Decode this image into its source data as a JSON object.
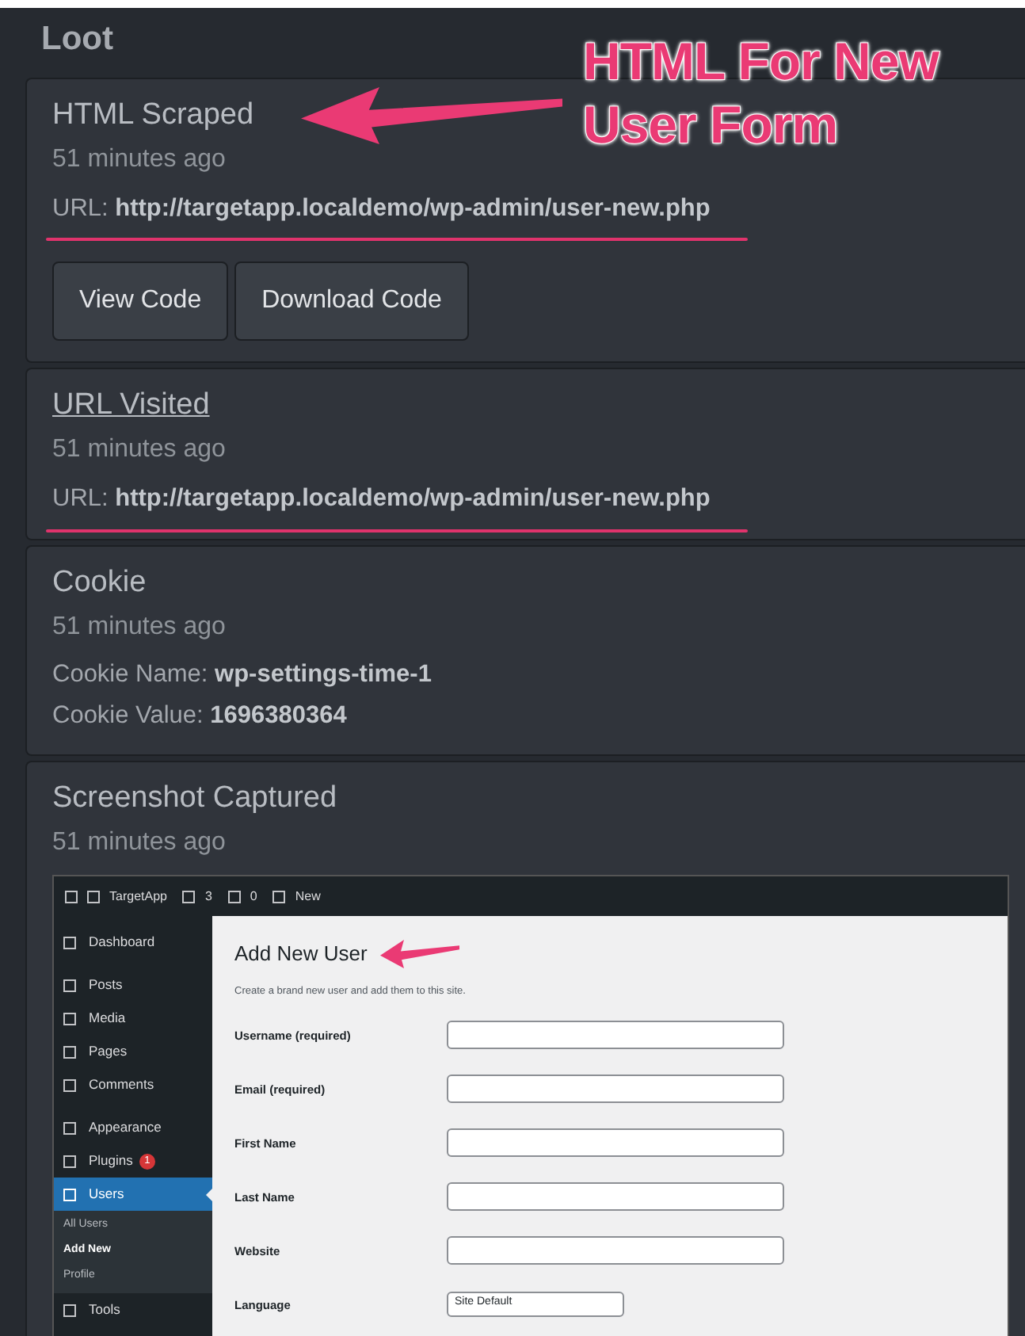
{
  "section_title": "Loot",
  "callout": {
    "text": "HTML For New User Form"
  },
  "loot_items": [
    {
      "kind": "html",
      "title": "HTML Scraped",
      "title_link": false,
      "title_arrow": true,
      "time": "51 minutes ago",
      "url_label": "URL:",
      "url": "http://targetapp.localdemo/wp-admin/user-new.php",
      "underlined": true,
      "buttons": [
        "View Code",
        "Download Code"
      ]
    },
    {
      "kind": "url",
      "title": "URL Visited",
      "title_link": true,
      "title_arrow": false,
      "time": "51 minutes ago",
      "url_label": "URL:",
      "url": "http://targetapp.localdemo/wp-admin/user-new.php",
      "underlined": true
    },
    {
      "kind": "cookie",
      "title": "Cookie",
      "title_link": false,
      "title_arrow": false,
      "time": "51 minutes ago",
      "fields": [
        {
          "label": "Cookie Name:",
          "value": "wp-settings-time-1"
        },
        {
          "label": "Cookie Value:",
          "value": "1696380364"
        }
      ]
    },
    {
      "kind": "screenshot",
      "title": "Screenshot Captured",
      "title_link": false,
      "title_arrow": false,
      "time": "51 minutes ago",
      "screenshot": {
        "admin_bar": [
          "TargetApp",
          "3",
          "0",
          "New"
        ],
        "menu_groups": [
          [
            {
              "label": "Dashboard",
              "selected": false
            }
          ],
          [
            {
              "label": "Posts",
              "selected": false
            },
            {
              "label": "Media",
              "selected": false
            },
            {
              "label": "Pages",
              "selected": false
            },
            {
              "label": "Comments",
              "selected": false
            }
          ],
          [
            {
              "label": "Appearance",
              "selected": false
            },
            {
              "label": "Plugins",
              "selected": false,
              "badge": "1"
            },
            {
              "label": "Users",
              "selected": true,
              "children": [
                {
                  "label": "All Users",
                  "selected": false
                },
                {
                  "label": "Add New",
                  "selected": true
                },
                {
                  "label": "Profile",
                  "selected": false
                }
              ]
            },
            {
              "label": "Tools",
              "selected": false
            }
          ]
        ],
        "heading": "Add New User",
        "heading_arrow": true,
        "description": "Create a brand new user and add them to this site.",
        "fields": [
          {
            "kind": "text",
            "label": "Username (required)"
          },
          {
            "kind": "text",
            "label": "Email (required)"
          },
          {
            "kind": "text",
            "label": "First Name"
          },
          {
            "kind": "text",
            "label": "Last Name"
          },
          {
            "kind": "text",
            "label": "Website"
          },
          {
            "kind": "select",
            "label": "Language",
            "value": "Site Default"
          }
        ]
      }
    }
  ]
}
